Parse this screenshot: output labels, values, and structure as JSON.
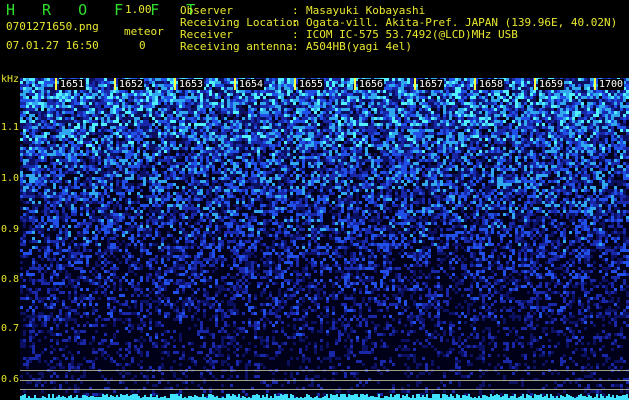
{
  "header": {
    "brand": "H R O F F T",
    "version": "1.00",
    "filename": "0701271650.png",
    "datetime": "07.01.27 16:50",
    "meteor_label": "meteor",
    "meteor_count": "0",
    "fields": [
      {
        "label": "Observer",
        "value": "Masayuki Kobayashi"
      },
      {
        "label": "Receiving Location",
        "value": "Ogata-vill. Akita-Pref. JAPAN (139.96E, 40.02N)"
      },
      {
        "label": "Receiver",
        "value": "ICOM IC-575 53.7492(@LCD)MHz USB"
      },
      {
        "label": "Receiving antenna",
        "value": "A504HB(yagi 4el)"
      }
    ]
  },
  "axis": {
    "unit": "kHz",
    "y_ticks": [
      "1.1",
      "1.0",
      "0.9",
      "0.8",
      "0.7",
      "0.6"
    ],
    "x_ticks": [
      "1651",
      "1652",
      "1653",
      "1654",
      "1655",
      "1656",
      "1657",
      "1658",
      "1659",
      "1700"
    ]
  },
  "colors": {
    "spectrum_hot": "#40e0ff",
    "spectrum_mid": "#1838d8",
    "spectrum_low": "#000030",
    "label_yellow": "#e8e830",
    "label_green": "#2ee02e"
  }
}
